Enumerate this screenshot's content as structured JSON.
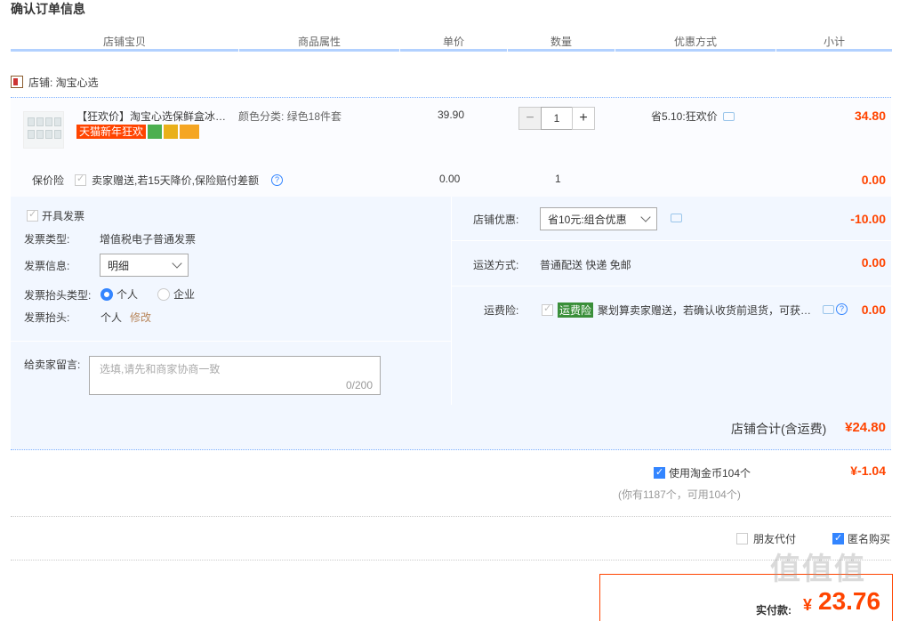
{
  "title": "确认订单信息",
  "columns": [
    "店铺宝贝",
    "商品属性",
    "单价",
    "数量",
    "优惠方式",
    "小计"
  ],
  "shop": {
    "label": "店铺: 淘宝心选"
  },
  "item": {
    "title": "【狂欢价】淘宝心选保鲜盒冰箱…",
    "tag": "天猫新年狂欢",
    "attr": "颜色分类: 绿色18件套",
    "price": "39.90",
    "quantity": "1",
    "promo": "省5.10:狂欢价",
    "subtotal": "34.80",
    "minus": "−",
    "plus": "+"
  },
  "insurance": {
    "label": "保价险",
    "text": "卖家赠送,若15天降价,保险赔付差额",
    "price": "0.00",
    "qty": "1",
    "subtotal": "0.00",
    "help": "?"
  },
  "invoice": {
    "open_label": "开具发票",
    "type_label": "发票类型:",
    "type_value": "增值税电子普通发票",
    "info_label": "发票信息:",
    "info_value": "明细",
    "header_type_label": "发票抬头类型:",
    "option_personal": "个人",
    "option_company": "企业",
    "header_label": "发票抬头:",
    "header_value": "个人",
    "edit": "修改"
  },
  "message": {
    "label": "给卖家留言:",
    "placeholder": "选填,请先和商家协商一致",
    "counter": "0/200"
  },
  "discount": {
    "label": "店铺优惠:",
    "value": "省10元:组合优惠",
    "amount": "-10.00"
  },
  "shipping": {
    "label": "运送方式:",
    "value": "普通配送 快递 免邮",
    "amount": "0.00"
  },
  "freight_ins": {
    "label": "运费险:",
    "tag": "运费险",
    "text": "聚划算卖家赠送，若确认收货前退货，可获…",
    "amount": "0.00",
    "help": "?"
  },
  "shop_total": {
    "label": "店铺合计(含运费)",
    "amount": "¥24.80"
  },
  "coins": {
    "label": "使用淘金币104个",
    "sub": "(你有1187个，可用104个)",
    "amount": "¥-1.04"
  },
  "options": {
    "friend_pay": "朋友代付",
    "anonymous": "匿名购买"
  },
  "payment": {
    "label": "实付款:",
    "currency": "¥",
    "amount": "23.76"
  },
  "watermark": "值值值"
}
